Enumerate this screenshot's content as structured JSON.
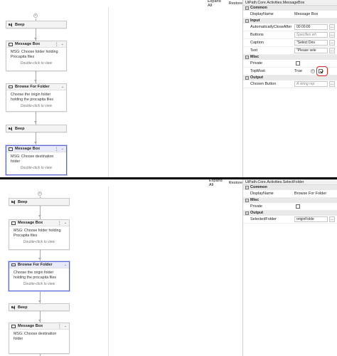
{
  "top": {
    "toolbar": {
      "expand_all": "Expand All",
      "restore": "Restore"
    },
    "designer": {
      "add_symbol": "+",
      "activities": [
        {
          "type": "beep",
          "title": "Beep"
        },
        {
          "type": "message",
          "title": "Message Box",
          "body": "MSG: Choose folder holding Procapita files",
          "hint": "Double-click to view"
        },
        {
          "type": "folder",
          "title": "Browse For Folder",
          "body": "Choose the origin folder holding the procapita files",
          "hint": "Double-click to view"
        },
        {
          "type": "beep",
          "title": "Beep"
        },
        {
          "type": "message",
          "title": "Message Box",
          "body": "MSG: Choose destination folder",
          "hint": "Double-click to view",
          "selected": true
        }
      ]
    },
    "properties": {
      "title": "UiPath.Core.Activities.MessageBox",
      "categories": {
        "common": "Common",
        "input": "Input",
        "misc": "Misc",
        "output": "Output"
      },
      "collapse_symbol": "−",
      "rows": {
        "display_name": {
          "label": "DisplayName",
          "value": "Message Box"
        },
        "auto_close": {
          "label": "AutomaticallyCloseAfter",
          "value": "00:00:00"
        },
        "buttons": {
          "label": "Buttons",
          "value": "Specifies wh"
        },
        "caption": {
          "label": "Caption",
          "value": "\"Select Des"
        },
        "text": {
          "label": "Text",
          "value": "\"Please sele"
        },
        "private": {
          "label": "Private"
        },
        "topmost": {
          "label": "TopMost",
          "value": "True"
        },
        "chosen_button": {
          "label": "Chosen Button",
          "value": "A string rep"
        }
      },
      "ellipsis": "..."
    }
  },
  "bottom": {
    "toolbar": {
      "expand_all": "Expand All",
      "restore": "Restore"
    },
    "designer": {
      "add_symbol": "+",
      "activities": [
        {
          "type": "beep",
          "title": "Beep"
        },
        {
          "type": "message",
          "title": "Message Box",
          "body": "MSG: Choose folder holding Procapita files",
          "hint": "Double-click to view"
        },
        {
          "type": "folder",
          "title": "Browse For Folder",
          "body": "Choose the origin folder holding the procapita files",
          "hint": "Double-click to view",
          "selected": true
        },
        {
          "type": "beep",
          "title": "Beep"
        },
        {
          "type": "message",
          "title": "Message Box",
          "body": "MSG: Choose destination folder",
          "hint": ""
        }
      ]
    },
    "properties": {
      "title": "UiPath.Core.Activities.SelectFolder",
      "categories": {
        "common": "Common",
        "misc": "Misc",
        "output": "Output"
      },
      "collapse_symbol": "−",
      "rows": {
        "display_name": {
          "label": "DisplayName",
          "value": "Browse For Folder"
        },
        "private": {
          "label": "Private"
        },
        "selected_folder": {
          "label": "SelectedFolder",
          "value": "originFolde"
        }
      },
      "ellipsis": "..."
    }
  },
  "colors": {
    "selected_border": "#5b6bd6",
    "highlight_ring": "#d9252b",
    "separator": "#000000"
  }
}
